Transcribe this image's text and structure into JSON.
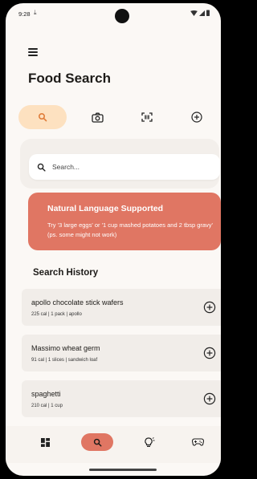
{
  "status_bar": {
    "time": "9:28",
    "download": "⤓"
  },
  "header": {
    "title": "Food Search",
    "menu_icon": "hamburger-icon"
  },
  "tabs": [
    {
      "icon": "search-icon",
      "active": true
    },
    {
      "icon": "camera-icon",
      "active": false
    },
    {
      "icon": "barcode-scan-icon",
      "active": false
    },
    {
      "icon": "add-circle-icon",
      "active": false
    }
  ],
  "search": {
    "placeholder": "Search..."
  },
  "banner": {
    "title": "Natural Language Supported",
    "text": "Try '3 large eggs' or '1 cup mashed potatoes and 2 tbsp gravy'  (ps. some might not work)"
  },
  "history": {
    "title": "Search History",
    "items": [
      {
        "name": "apollo chocolate stick wafers",
        "meta": "225 cal  |  1 pack  |  apollo"
      },
      {
        "name": "Massimo wheat germ",
        "meta": "91 cal  |  1 slices  |  sandwich loaf"
      },
      {
        "name": "spaghetti",
        "meta": "210 cal  |  1 cup"
      }
    ]
  },
  "bottom_nav": [
    {
      "icon": "dashboard-icon",
      "active": false
    },
    {
      "icon": "search-icon",
      "active": true
    },
    {
      "icon": "lightbulb-icon",
      "active": false
    },
    {
      "icon": "gamepad-icon",
      "active": false
    }
  ],
  "colors": {
    "accent": "#e07663",
    "tab_active": "#fde1c0",
    "background": "#fbf8f5"
  }
}
